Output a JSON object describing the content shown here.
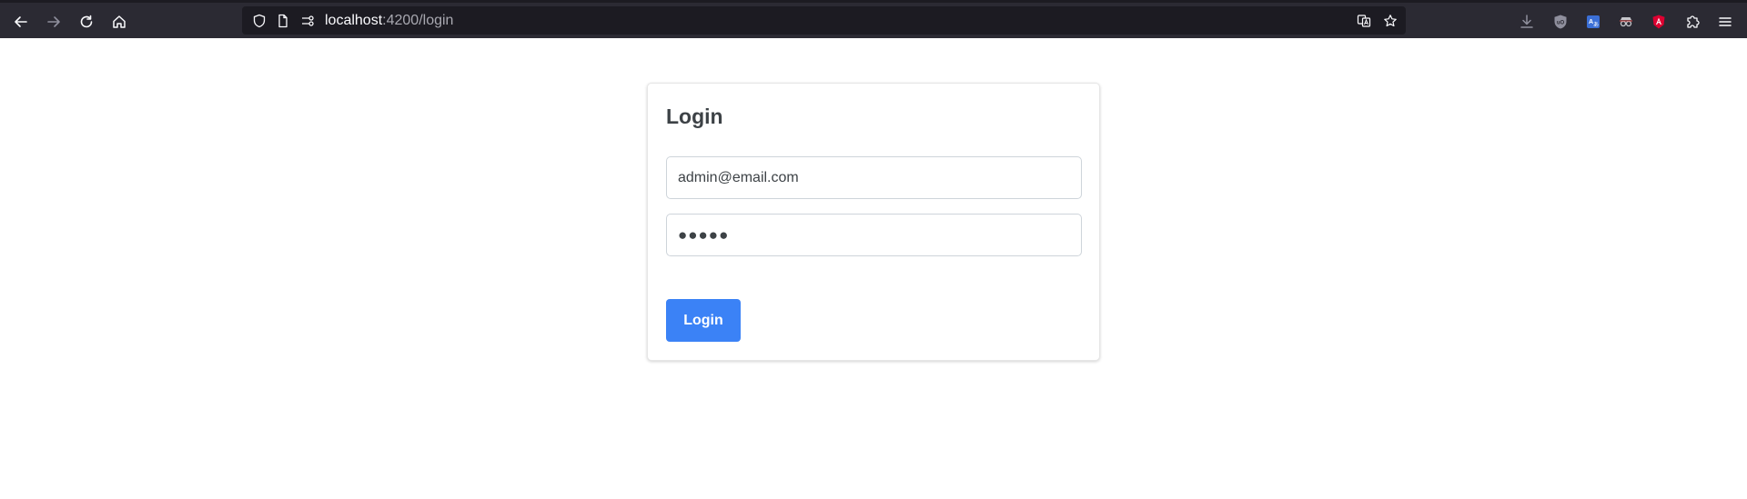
{
  "browser": {
    "url_host": "localhost",
    "url_path": ":4200/login",
    "icons": [
      "back-arrow-icon",
      "forward-arrow-icon",
      "reload-icon",
      "home-icon",
      "shield-icon",
      "page-icon",
      "permissions-icon",
      "translate-icon",
      "bookmark-star-icon",
      "download-icon",
      "ublock-icon",
      "translator-extension-icon",
      "spy-extension-icon",
      "angular-icon",
      "extensions-puzzle-icon",
      "menu-icon"
    ]
  },
  "login": {
    "title": "Login",
    "email_value": "admin@email.com",
    "password_masked": "●●●●●",
    "button_label": "Login"
  },
  "colors": {
    "chrome_bg": "#2b2a33",
    "urlbar_bg": "#1c1b22",
    "primary_button": "#3b82f6",
    "text": "#3d4246"
  }
}
